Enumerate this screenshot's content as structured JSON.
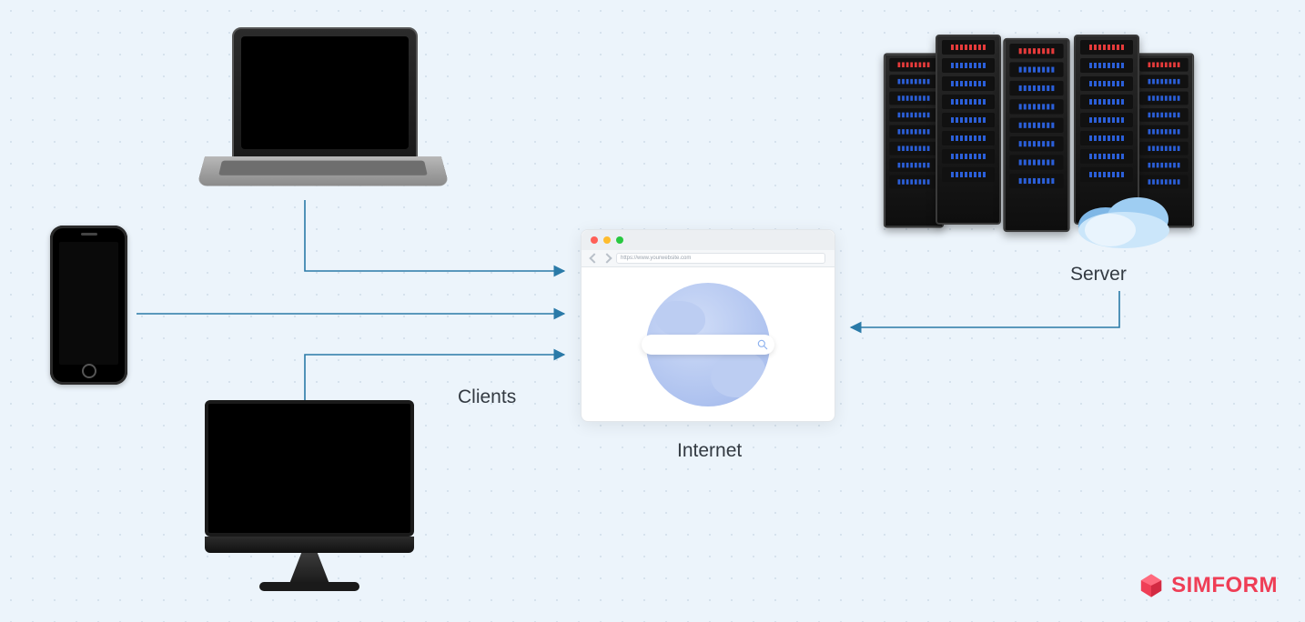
{
  "labels": {
    "clients": "Clients",
    "internet": "Internet",
    "server": "Server"
  },
  "browser": {
    "url": "https://www.yourwebsite.com"
  },
  "brand": {
    "name": "SIMFORM"
  },
  "icons": {
    "laptop": "laptop-icon",
    "phone": "smartphone-icon",
    "monitor": "desktop-monitor-icon",
    "browser_globe": "globe-icon",
    "search": "search-icon",
    "server_rack": "server-rack-icon",
    "cloud": "cloud-icon",
    "logo_mark": "simform-logo-mark"
  },
  "colors": {
    "arrow": "#2a7aa8",
    "brand": "#ef3e56",
    "background": "#ecf4fb"
  },
  "diagram": {
    "nodes": [
      "laptop",
      "phone",
      "monitor",
      "internet",
      "server"
    ],
    "edges": [
      {
        "from": "laptop",
        "to": "internet"
      },
      {
        "from": "phone",
        "to": "internet"
      },
      {
        "from": "monitor",
        "to": "internet"
      },
      {
        "from": "server",
        "to": "internet"
      }
    ]
  }
}
